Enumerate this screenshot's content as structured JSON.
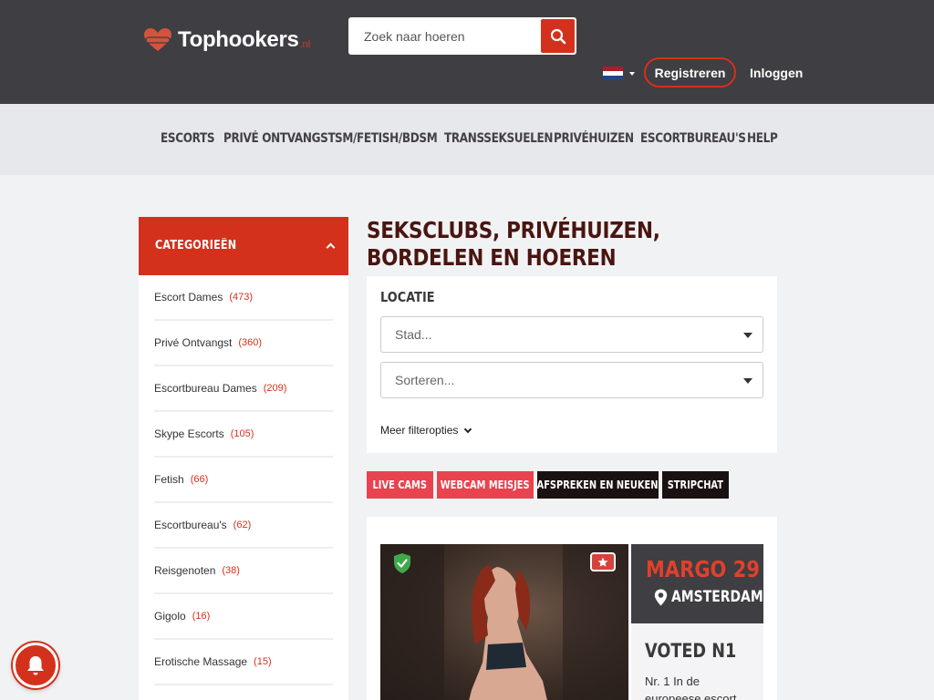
{
  "header": {
    "logo_text": "Tophookers",
    "logo_tld": ".nl",
    "search_placeholder": "Zoek naar hoeren",
    "register_label": "Registreren",
    "login_label": "Inloggen"
  },
  "nav": {
    "items": [
      "ESCORTS",
      "PRIVÉ ONTVANGST",
      "SM/FETISH/BDSM",
      "TRANSSEKSUELEN",
      "PRIVÉHUIZEN",
      "ESCORTBUREAU'S",
      "HELP"
    ]
  },
  "sidebar": {
    "title": "CATEGORIEËN",
    "items": [
      {
        "label": "Escort Dames",
        "count": "(473)"
      },
      {
        "label": "Privé Ontvangst",
        "count": "(360)"
      },
      {
        "label": "Escortbureau Dames",
        "count": "(209)"
      },
      {
        "label": "Skype Escorts",
        "count": "(105)"
      },
      {
        "label": "Fetish",
        "count": "(66)"
      },
      {
        "label": "Escortbureau's",
        "count": "(62)"
      },
      {
        "label": "Reisgenoten",
        "count": "(38)"
      },
      {
        "label": "Gigolo",
        "count": "(16)"
      },
      {
        "label": "Erotische Massage",
        "count": "(15)"
      }
    ]
  },
  "main": {
    "title": "SEKSCLUBS, PRIVÉHUIZEN, BORDELEN EN HOEREN",
    "filter": {
      "location_label": "LOCATIE",
      "city_select": "Stad...",
      "sort_select": "Sorteren...",
      "more_filters": "Meer filteropties"
    },
    "promo_buttons": [
      "LIVE CAMS",
      "WEBCAM MEISJES",
      "AFSPREKEN EN NEUKEN",
      "STRIPCHAT"
    ],
    "listing": {
      "name_age": "MARGO 29",
      "city": "AMSTERDAM",
      "voted": "VOTED N1",
      "description": "Nr. 1 In de europeese escort"
    }
  },
  "colors": {
    "header_bg": "#3f3e42",
    "accent": "#d4311c",
    "nav_bg": "#e6e8ec",
    "page_bg": "#f1f2f4",
    "promo_pink": "#e8434f",
    "promo_black": "#1a1212"
  },
  "icons": [
    "heart-logo-icon",
    "search-icon",
    "netherlands-flag-icon",
    "chevron-up-icon",
    "dropdown-arrow-icon",
    "chevron-down-icon",
    "verified-shield-icon",
    "star-icon",
    "location-pin-icon",
    "bell-icon"
  ]
}
